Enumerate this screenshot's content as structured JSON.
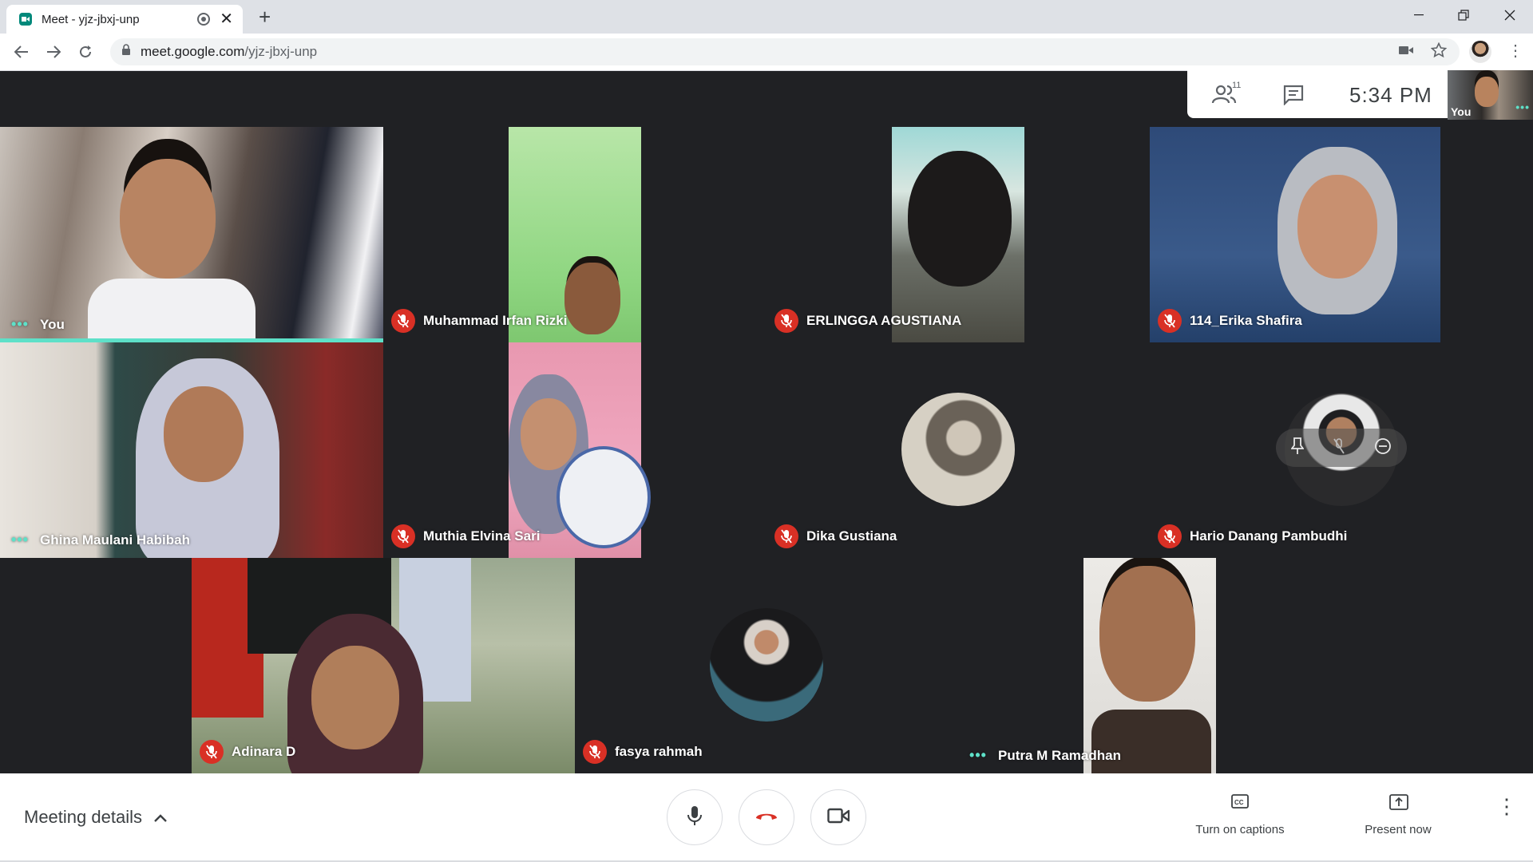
{
  "browser": {
    "tab_title": "Meet - yjz-jbxj-unp",
    "url_domain": "meet.google.com",
    "url_path": "/yjz-jbxj-unp"
  },
  "meet": {
    "participant_count": "11",
    "time": "5:34 PM",
    "self_label": "You"
  },
  "participants": [
    {
      "name": "You",
      "state": "speaking"
    },
    {
      "name": "Muhammad Irfan Rizki",
      "state": "muted"
    },
    {
      "name": "ERLINGGA AGUSTIANA",
      "state": "muted"
    },
    {
      "name": "114_Erika Shafira",
      "state": "muted"
    },
    {
      "name": "Ghina Maulani Habibah",
      "state": "speaking"
    },
    {
      "name": "Muthia Elvina Sari",
      "state": "muted"
    },
    {
      "name": "Dika Gustiana",
      "state": "muted"
    },
    {
      "name": "Hario Danang Pambudhi",
      "state": "muted"
    },
    {
      "name": "Adinara D",
      "state": "muted"
    },
    {
      "name": "fasya rahmah",
      "state": "muted"
    },
    {
      "name": "Putra M Ramadhan",
      "state": "speaking"
    }
  ],
  "controls": {
    "meeting_details": "Meeting details",
    "captions": "Turn on captions",
    "present": "Present now"
  },
  "colors": {
    "accent_teal": "#5ee0c8",
    "mute_red": "#d93025",
    "hangup_red": "#d93025",
    "grid_bg": "#202124"
  }
}
